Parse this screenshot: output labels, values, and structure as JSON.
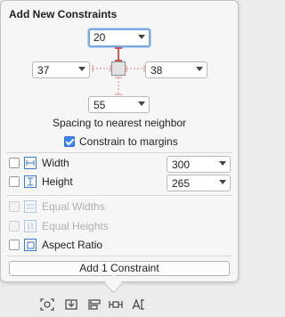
{
  "popover": {
    "title": "Add New Constraints",
    "spacing": {
      "top": "20",
      "left": "37",
      "right": "38",
      "bottom": "55",
      "caption": "Spacing to nearest neighbor"
    },
    "constrain_margins": {
      "label": "Constrain to margins",
      "checked": true
    },
    "rows": [
      {
        "label": "Width",
        "value": "300",
        "enabled": true
      },
      {
        "label": "Height",
        "value": "265",
        "enabled": true
      },
      {
        "label": "Equal Widths",
        "enabled": false
      },
      {
        "label": "Equal Heights",
        "enabled": false
      },
      {
        "label": "Aspect Ratio",
        "enabled": true
      }
    ],
    "add_button": "Add 1 Constraint"
  },
  "toolbar": {
    "icons": [
      "update-frames-icon",
      "embed-in-icon",
      "align-icon",
      "pin-icon",
      "resolve-auto-layout-icon"
    ]
  },
  "colors": {
    "accent": "#3b82f6",
    "strut": "#c62828"
  }
}
